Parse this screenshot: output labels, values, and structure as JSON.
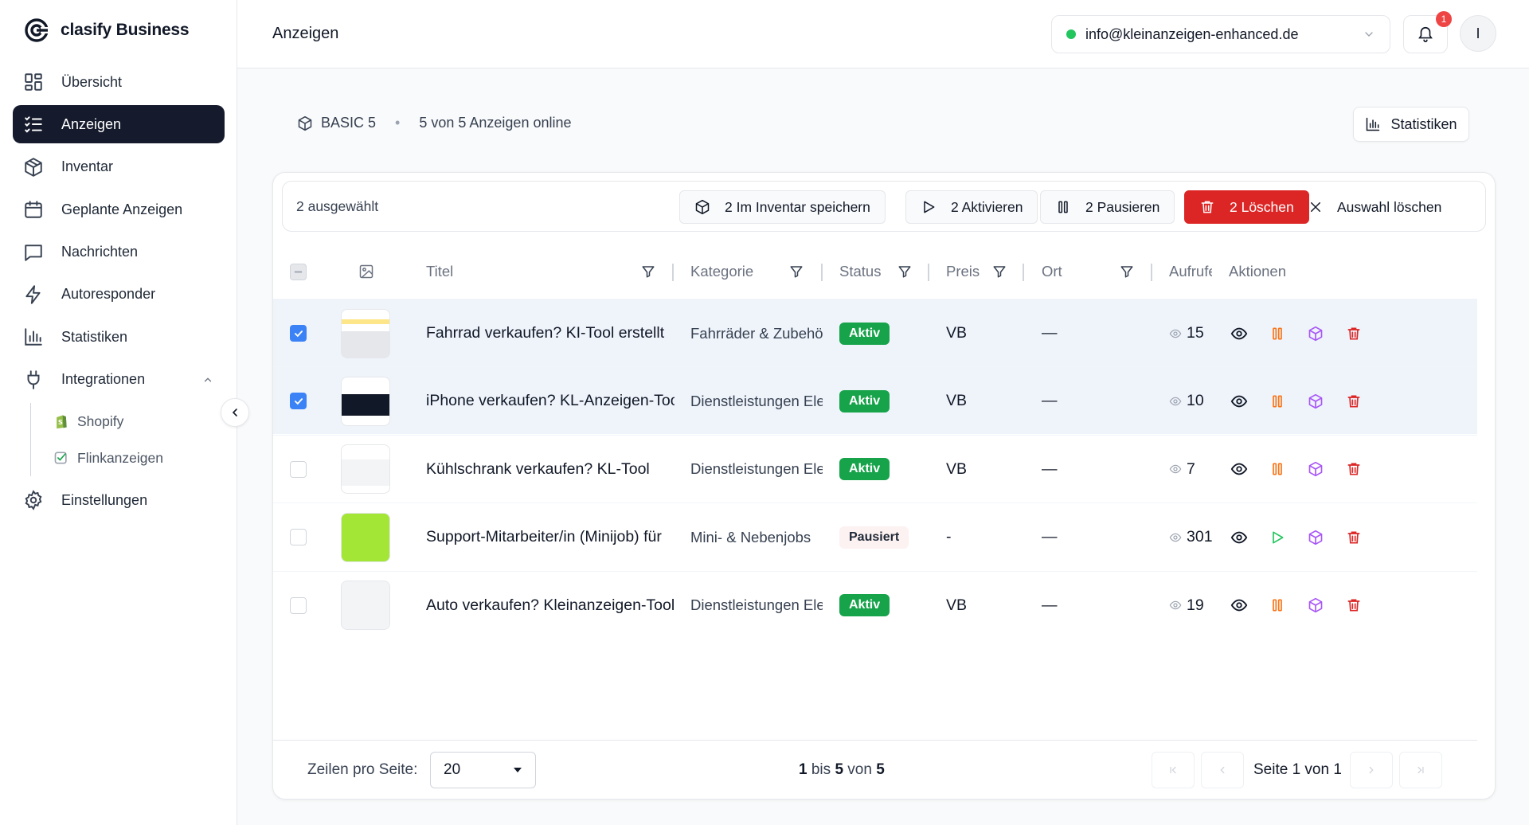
{
  "brand": {
    "name": "clasify Business"
  },
  "sidebar": {
    "items": [
      {
        "label": "Übersicht",
        "icon": "grid-icon",
        "active": false
      },
      {
        "label": "Anzeigen",
        "icon": "list-check-icon",
        "active": true
      },
      {
        "label": "Inventar",
        "icon": "box-icon",
        "active": false
      },
      {
        "label": "Geplante Anzeigen",
        "icon": "calendar-icon",
        "active": false
      },
      {
        "label": "Nachrichten",
        "icon": "message-icon",
        "active": false
      },
      {
        "label": "Autoresponder",
        "icon": "lightning-icon",
        "active": false
      },
      {
        "label": "Statistiken",
        "icon": "bar-chart-icon",
        "active": false
      },
      {
        "label": "Integrationen",
        "icon": "plug-icon",
        "active": false
      }
    ],
    "subitems": [
      {
        "label": "Shopify",
        "icon": "shopify-icon"
      },
      {
        "label": "Flinkanzeigen",
        "icon": "flinkanzeigen-icon"
      }
    ],
    "settings_label": "Einstellungen"
  },
  "header": {
    "title": "Anzeigen",
    "account_email": "info@kleinanzeigen-enhanced.de",
    "notification_count": "1",
    "avatar_initial": "I"
  },
  "plan": {
    "name": "BASIC 5",
    "online_text": "5 von 5 Anzeigen online",
    "stats_button": "Statistiken"
  },
  "bulk": {
    "selected_text": "2 ausgewählt",
    "save_inventory": "2 Im Inventar speichern",
    "activate": "2 Aktivieren",
    "pause": "2 Pausieren",
    "delete": "2 Löschen",
    "clear_selection": "Auswahl löschen"
  },
  "table": {
    "columns": {
      "title": "Titel",
      "category": "Kategorie",
      "status": "Status",
      "price": "Preis",
      "location": "Ort",
      "views": "Aufrufe",
      "actions": "Aktionen"
    },
    "rows": [
      {
        "selected": true,
        "title": "Fahrrad verkaufen? KI-Tool erstellt",
        "category": "Fahrräder & Zubehör",
        "status": "Aktiv",
        "price": "VB",
        "location": "—",
        "views": "15",
        "toggle": "pause"
      },
      {
        "selected": true,
        "title": "iPhone verkaufen? KL-Anzeigen-Tool",
        "category": "Dienstleistungen Elektronik",
        "status": "Aktiv",
        "price": "VB",
        "location": "—",
        "views": "10",
        "toggle": "pause"
      },
      {
        "selected": false,
        "title": "Kühlschrank verkaufen? KL-Tool",
        "category": "Dienstleistungen Elektronik",
        "status": "Aktiv",
        "price": "VB",
        "location": "—",
        "views": "7",
        "toggle": "pause"
      },
      {
        "selected": false,
        "title": "Support-Mitarbeiter/in (Minijob) für",
        "category": "Mini- & Nebenjobs",
        "status": "Pausiert",
        "price": "-",
        "location": "—",
        "views": "301",
        "toggle": "play"
      },
      {
        "selected": false,
        "title": "Auto verkaufen? Kleinanzeigen-Tool",
        "category": "Dienstleistungen Elektronik",
        "status": "Aktiv",
        "price": "VB",
        "location": "—",
        "views": "19",
        "toggle": "pause"
      }
    ]
  },
  "footer": {
    "rows_per_page_label": "Zeilen pro Seite:",
    "rows_per_page_value": "20",
    "range_from": "1",
    "range_mid": " bis ",
    "range_to": "5",
    "range_of": " von ",
    "range_total": "5",
    "page_info": "Seite 1 von 1"
  },
  "colors": {
    "sidebar_active": "#151b2c",
    "status_active": "#16a34a",
    "danger": "#dc2626",
    "checkbox": "#3b82f6",
    "pause_icon": "#f97316",
    "play_icon": "#22c55e",
    "inventory_icon": "#a855f7"
  }
}
